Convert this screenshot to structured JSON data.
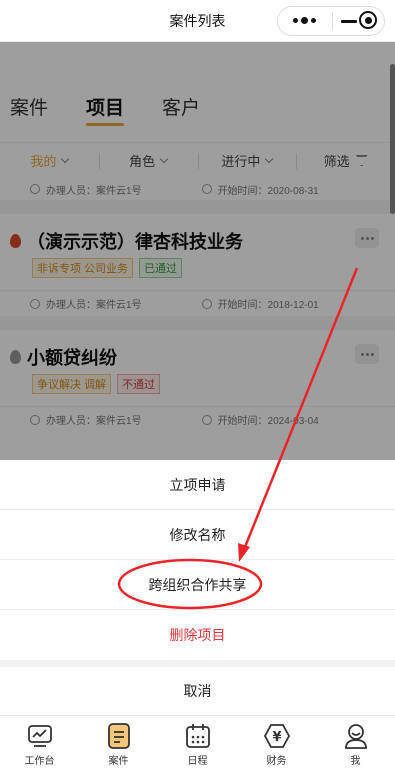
{
  "header": {
    "title": "案件列表"
  },
  "tabs": [
    {
      "label": "案件"
    },
    {
      "label": "项目"
    },
    {
      "label": "客户"
    }
  ],
  "filters": [
    {
      "label": "我的"
    },
    {
      "label": "角色"
    },
    {
      "label": "进行中"
    },
    {
      "label": "筛选"
    }
  ],
  "top_meta": {
    "handler": "办理人员：案件云1号",
    "start": "开始时间：2020-08-31"
  },
  "cards": [
    {
      "title": "（演示示范）律杏科技业务",
      "drop_color": "#d94b2b",
      "tags": [
        {
          "text": "非诉专项 公司业务",
          "style": "orange"
        },
        {
          "text": "已通过",
          "style": "green"
        }
      ],
      "handler": "办理人员：案件云1号",
      "start": "开始时间：2018-12-01"
    },
    {
      "title": "小额贷纠纷",
      "drop_color": "#999999",
      "tags": [
        {
          "text": "争议解决 调解",
          "style": "orange"
        },
        {
          "text": "不通过",
          "style": "red"
        }
      ],
      "handler": "办理人员：案件云1号",
      "start": "开始时间：2024-03-04"
    }
  ],
  "action_sheet": {
    "items": [
      {
        "label": "立项申请"
      },
      {
        "label": "修改名称"
      },
      {
        "label": "跨组织合作共享"
      },
      {
        "label": "删除项目"
      }
    ],
    "cancel": "取消"
  },
  "tabbar": [
    {
      "label": "工作台",
      "icon": "chart-icon"
    },
    {
      "label": "案件",
      "icon": "case-icon"
    },
    {
      "label": "日程",
      "icon": "calendar-icon"
    },
    {
      "label": "财务",
      "icon": "finance-icon"
    },
    {
      "label": "我",
      "icon": "user-icon"
    }
  ],
  "colors": {
    "accent": "#e8a93a",
    "danger": "#e2393c",
    "annotation": "#e8262a"
  }
}
